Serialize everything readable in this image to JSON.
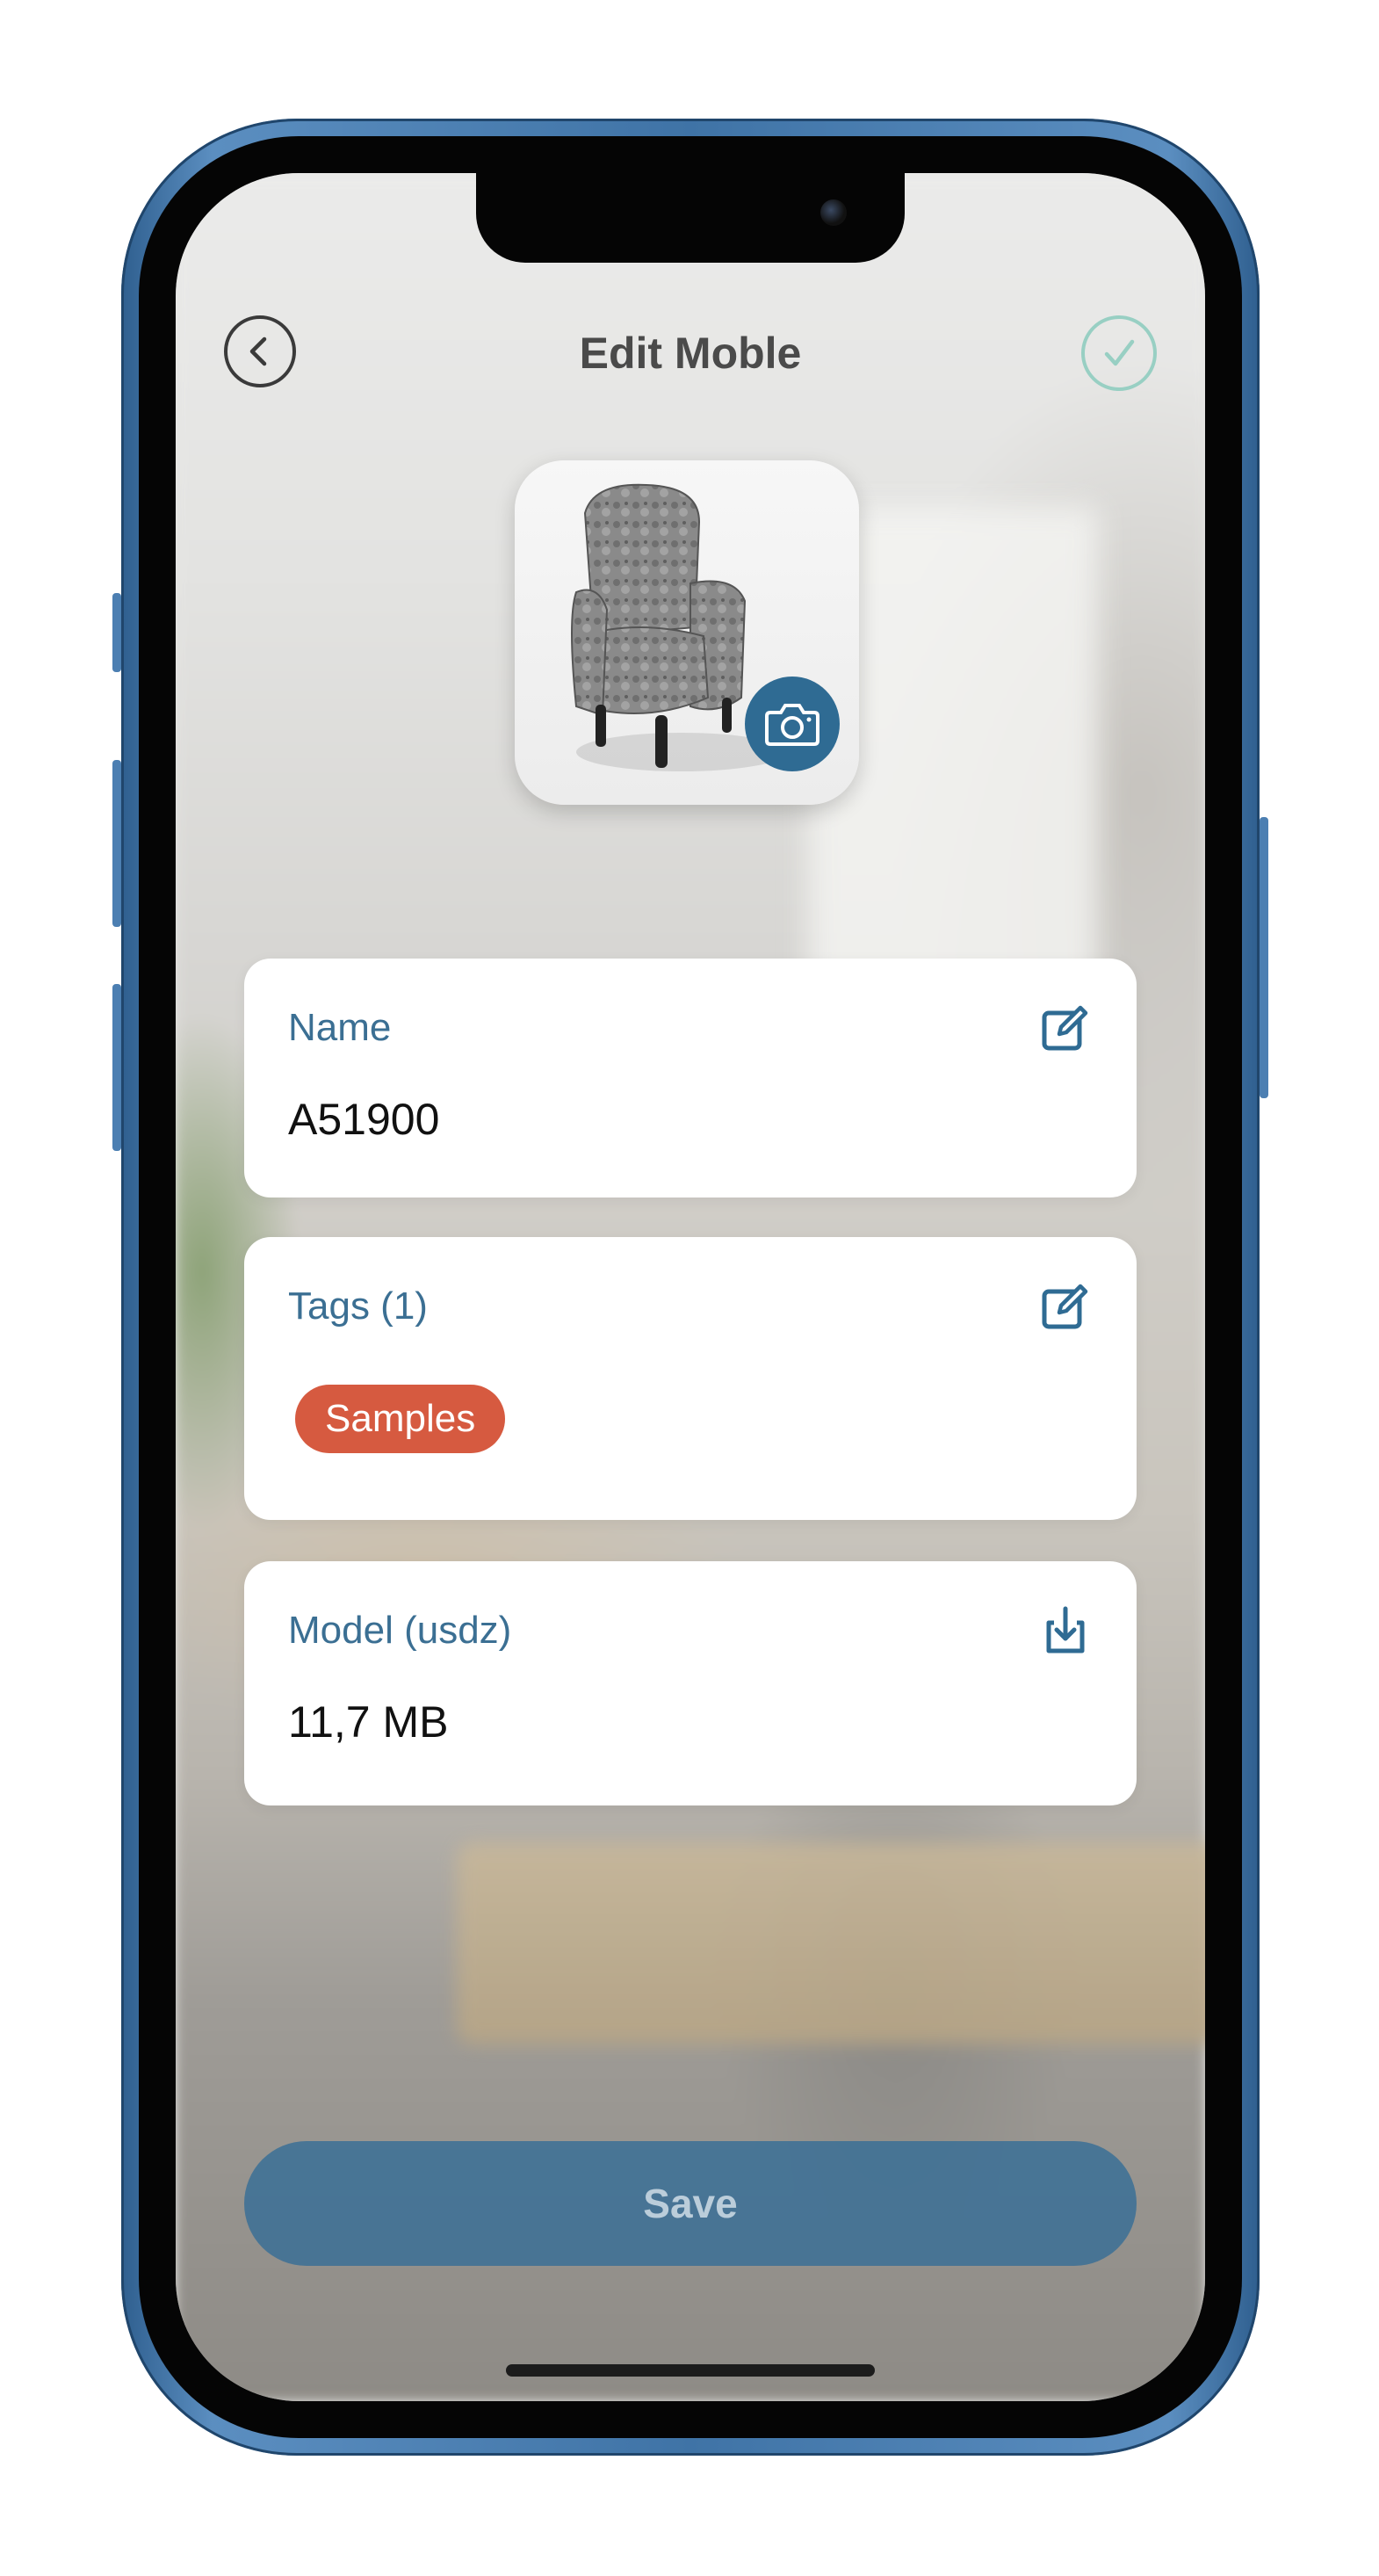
{
  "header": {
    "title": "Edit Moble",
    "back_icon": "chevron-left-circle-icon",
    "done_icon": "checkmark-circle-icon"
  },
  "thumbnail": {
    "image": "armchair",
    "badge_icon": "camera-icon"
  },
  "cards": {
    "name": {
      "label": "Name",
      "value": "A51900",
      "icon": "edit-icon"
    },
    "tags": {
      "label": "Tags (1)",
      "items": [
        "Samples"
      ],
      "icon": "edit-icon",
      "chip_color": "#d65a40"
    },
    "model": {
      "label": "Model (usdz)",
      "value": "11,7 MB",
      "icon": "download-icon"
    }
  },
  "footer": {
    "save_label": "Save"
  },
  "colors": {
    "accent": "#2f6b93",
    "label": "#3b6f93",
    "done": "#98cfc3"
  }
}
